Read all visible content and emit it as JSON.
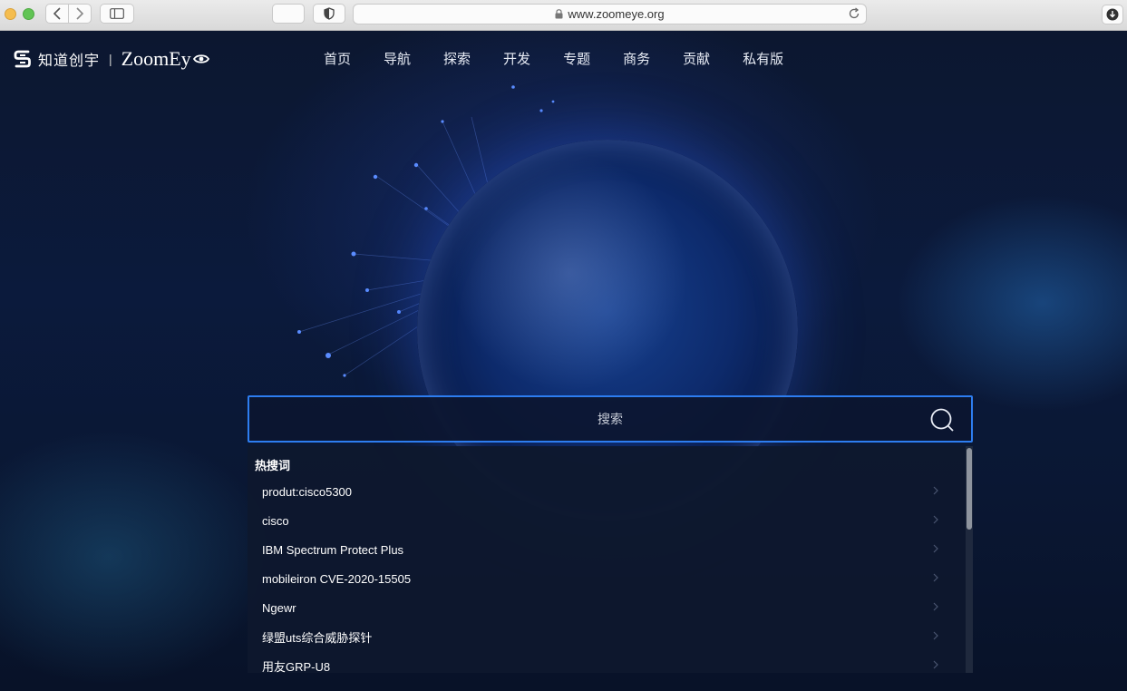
{
  "browser": {
    "url": "www.zoomeye.org"
  },
  "logo": {
    "cn": "知道创宇",
    "sep": "|",
    "en": "ZoomEy"
  },
  "nav": {
    "items": [
      {
        "label": "首页"
      },
      {
        "label": "导航"
      },
      {
        "label": "探索"
      },
      {
        "label": "开发"
      },
      {
        "label": "专题"
      },
      {
        "label": "商务"
      },
      {
        "label": "贡献"
      },
      {
        "label": "私有版"
      }
    ]
  },
  "search": {
    "placeholder": "搜索"
  },
  "hot": {
    "title": "热搜词",
    "items": [
      {
        "label": "produt:cisco5300"
      },
      {
        "label": "cisco"
      },
      {
        "label": "IBM Spectrum Protect Plus"
      },
      {
        "label": "mobileiron CVE-2020-15505"
      },
      {
        "label": "Ngewr"
      },
      {
        "label": "绿盟uts综合威胁探针"
      },
      {
        "label": "用友GRP-U8"
      }
    ]
  },
  "colors": {
    "accent": "#2d7df0",
    "background": "#0b1a3c"
  }
}
